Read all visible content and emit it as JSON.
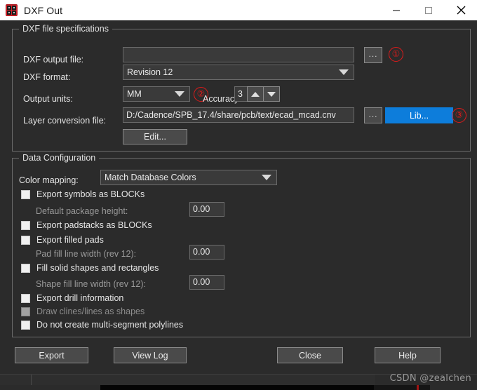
{
  "window": {
    "title": "DXF Out",
    "icon": "dxf-app-icon",
    "controls": {
      "minimize": "minimize-icon",
      "maximize": "maximize-icon",
      "close": "close-icon"
    }
  },
  "specs": {
    "group_title": "DXF file specifications",
    "output_file": {
      "label": "DXF output file:",
      "value": "",
      "placeholder": ""
    },
    "format": {
      "label": "DXF format:",
      "value": "Revision 12"
    },
    "units": {
      "label": "Output units:",
      "value": "MM"
    },
    "accuracy": {
      "label": "Accuracy:",
      "value": "3"
    },
    "layer_conversion": {
      "label": "Layer conversion file:",
      "value": "D:/Cadence/SPB_17.4/share/pcb/text/ecad_mcad.cnv"
    },
    "browse_label": "...",
    "lib_label": "Lib...",
    "edit_label": "Edit..."
  },
  "data_config": {
    "group_title": "Data Configuration",
    "color_mapping": {
      "label": "Color mapping:",
      "value": "Match Database Colors"
    },
    "options": [
      {
        "label": "Export symbols as BLOCKs",
        "checked": false,
        "enabled": true
      },
      {
        "label": "Export padstacks as BLOCKs",
        "checked": false,
        "enabled": true
      },
      {
        "label": "Export filled pads",
        "checked": false,
        "enabled": true
      },
      {
        "label": "Fill solid shapes and rectangles",
        "checked": false,
        "enabled": true
      },
      {
        "label": "Export drill information",
        "checked": false,
        "enabled": true
      },
      {
        "label": "Draw clines/lines as shapes",
        "checked": false,
        "enabled": false
      },
      {
        "label": "Do not create multi-segment polylines",
        "checked": false,
        "enabled": true
      }
    ],
    "fields": [
      {
        "label": "Default package height:",
        "value": "0.00"
      },
      {
        "label": "Pad fill line width (rev 12):",
        "value": "0.00"
      },
      {
        "label": "Shape fill line width (rev 12):",
        "value": "0.00"
      }
    ]
  },
  "footer": {
    "export_label": "Export",
    "view_log_label": "View Log",
    "close_label": "Close",
    "help_label": "Help"
  },
  "annotations": [
    {
      "id": "annotation-1",
      "text": "①"
    },
    {
      "id": "annotation-2",
      "text": "②"
    },
    {
      "id": "annotation-3",
      "text": "③"
    }
  ],
  "watermark": "CSDN @zealchen",
  "colors": {
    "dialog_bg": "#2b2b2b",
    "titlebar_bg": "#ffffff",
    "field_bg": "#3a3a3a",
    "accent_blue": "#0d7ddb",
    "annotation_red": "#e01b1b"
  }
}
